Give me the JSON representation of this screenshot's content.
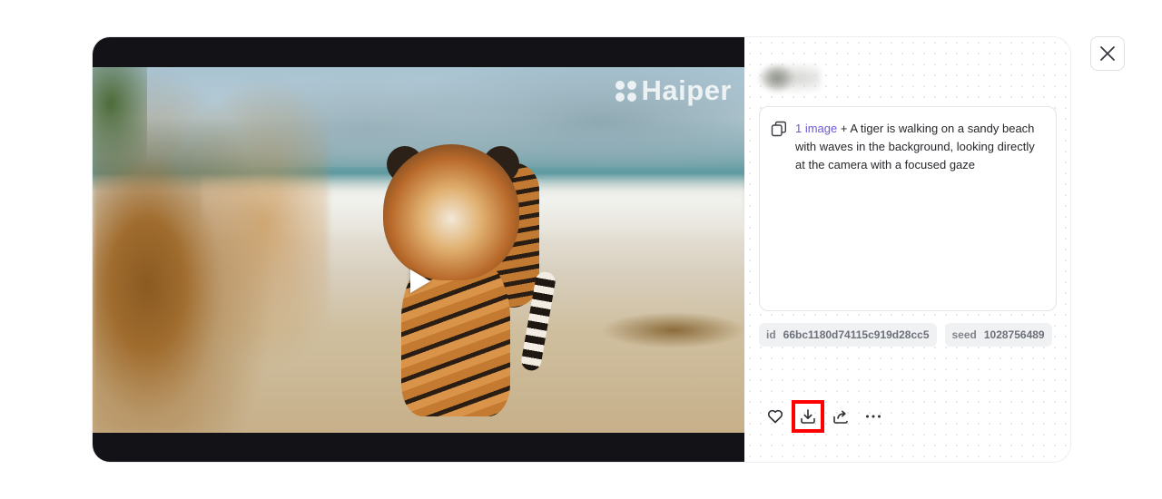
{
  "video": {
    "watermark": "Haiper",
    "play_icon": "play-icon"
  },
  "panel": {
    "prompt": {
      "copy_icon": "copy-icon",
      "link_text": "1 image",
      "text": " + A tiger is walking on a sandy beach with waves in the background, looking directly at the camera with a focused gaze"
    },
    "tags": {
      "id_label": "id",
      "id_value": "66bc1180d74115c919d28cc5",
      "seed_label": "seed",
      "seed_value": "1028756489"
    },
    "actions": [
      "heart-icon",
      "download-icon",
      "share-icon",
      "more-icon"
    ]
  },
  "colors": {
    "link": "#6f57d9",
    "highlight": "#ff0000",
    "video_bg": "#121217"
  }
}
